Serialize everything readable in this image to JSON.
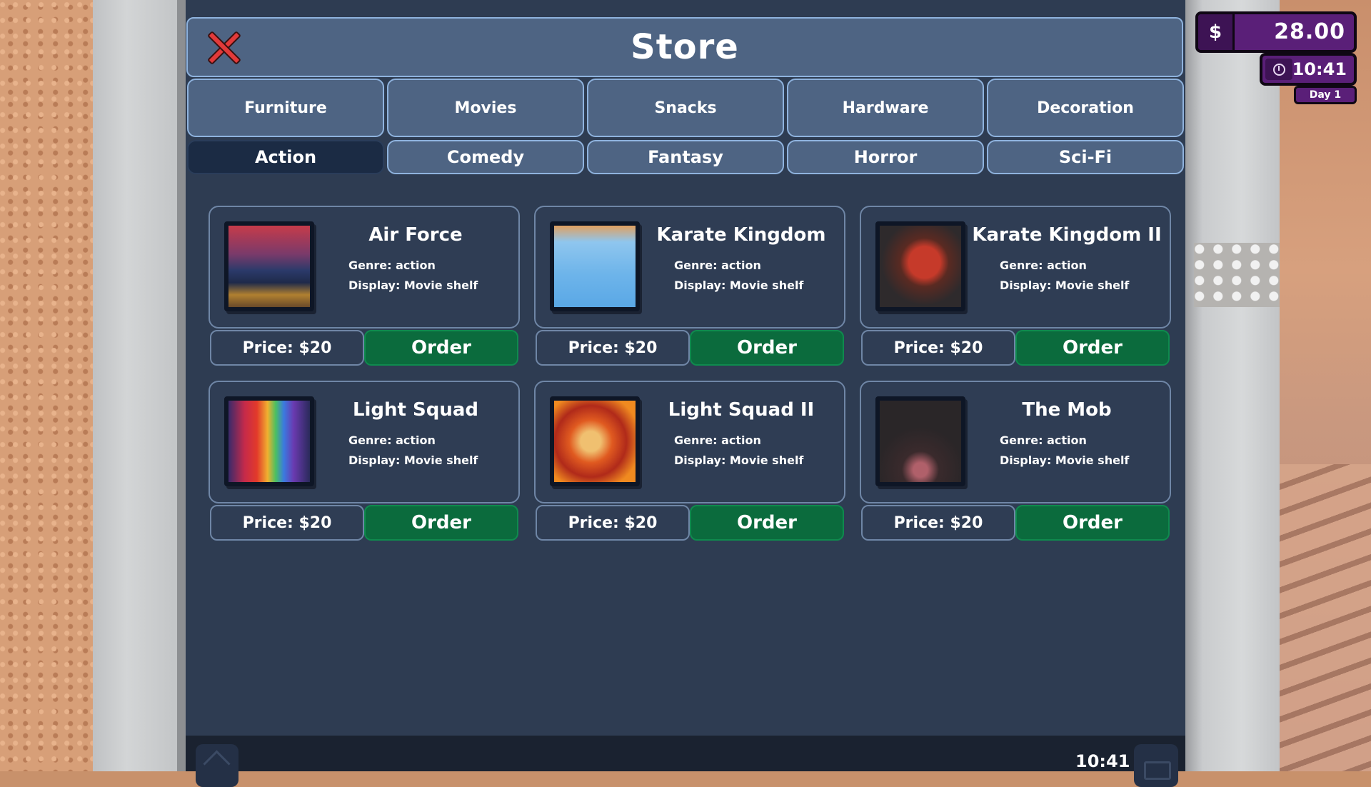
{
  "store": {
    "title": "Store",
    "categories": [
      "Furniture",
      "Movies",
      "Snacks",
      "Hardware",
      "Decoration"
    ],
    "genres": [
      "Action",
      "Comedy",
      "Fantasy",
      "Horror",
      "Sci-Fi"
    ],
    "active_genre": "Action",
    "products": [
      {
        "title": "Air Force",
        "genre": "Genre: action",
        "display": "Display: Movie shelf",
        "price": "Price: $20",
        "order": "Order"
      },
      {
        "title": "Karate Kingdom",
        "genre": "Genre: action",
        "display": "Display: Movie shelf",
        "price": "Price: $20",
        "order": "Order"
      },
      {
        "title": "Karate Kingdom II",
        "genre": "Genre: action",
        "display": "Display: Movie shelf",
        "price": "Price: $20",
        "order": "Order"
      },
      {
        "title": "Light Squad",
        "genre": "Genre: action",
        "display": "Display: Movie shelf",
        "price": "Price: $20",
        "order": "Order"
      },
      {
        "title": "Light Squad II",
        "genre": "Genre: action",
        "display": "Display: Movie shelf",
        "price": "Price: $20",
        "order": "Order"
      },
      {
        "title": "The Mob",
        "genre": "Genre: action",
        "display": "Display: Movie shelf",
        "price": "Price: $20",
        "order": "Order"
      }
    ]
  },
  "hud": {
    "currency_symbol": "$",
    "money": "28.00",
    "clock": "10:41",
    "day": "Day 1"
  },
  "bottom_bar": {
    "time": "10:41"
  },
  "colors": {
    "panel": "#2e3c52",
    "tab": "#4e6483",
    "active_tab": "#1b2b44",
    "order_button": "#0b6b3d",
    "close_x": "#e23a3a",
    "hud": "#5a1f78"
  }
}
